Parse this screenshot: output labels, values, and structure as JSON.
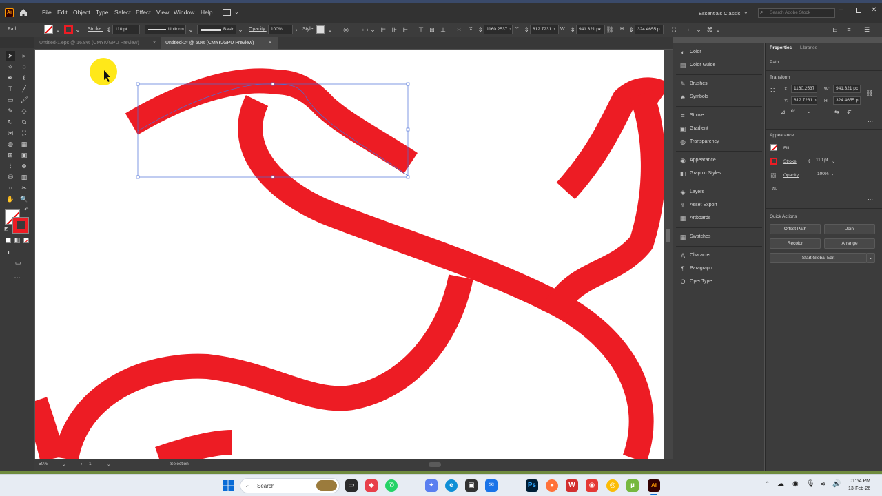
{
  "menubar": {
    "app_badge": "Ai",
    "items": [
      "File",
      "Edit",
      "Object",
      "Type",
      "Select",
      "Effect",
      "View",
      "Window",
      "Help"
    ],
    "workspace": "Essentials Classic",
    "search_placeholder": "Search Adobe Stock"
  },
  "controlbar": {
    "selection_type": "Path",
    "stroke_label": "Stroke:",
    "stroke_value": "110 pt",
    "profile": "Uniform",
    "brush": "Basic",
    "opacity_label": "Opacity:",
    "opacity_value": "100%",
    "style_label": "Style:",
    "x_label": "X:",
    "x_value": "1160.2537 p",
    "y_label": "Y:",
    "y_value": "812.7231 p",
    "w_label": "W:",
    "w_value": "941.321 px",
    "h_label": "H:",
    "h_value": "324.4655 p"
  },
  "tabs": [
    {
      "label": "Untitled-1.eps @ 16.8% (CMYK/GPU Preview)",
      "close": "×"
    },
    {
      "label": "Untitled-2* @ 50% (CMYK/GPU Preview)",
      "close": "×"
    }
  ],
  "statusbar": {
    "zoom": "50%",
    "artboard": "1",
    "tool": "Selection"
  },
  "panels": [
    {
      "label": "Color",
      "icon": "color-icon"
    },
    {
      "label": "Color Guide",
      "icon": "color-guide-icon"
    },
    {
      "label": "Brushes",
      "icon": "brushes-icon"
    },
    {
      "label": "Symbols",
      "icon": "symbols-icon"
    },
    {
      "label": "Stroke",
      "icon": "stroke-icon"
    },
    {
      "label": "Gradient",
      "icon": "gradient-icon"
    },
    {
      "label": "Transparency",
      "icon": "transparency-icon"
    },
    {
      "label": "Appearance",
      "icon": "appearance-icon"
    },
    {
      "label": "Graphic Styles",
      "icon": "graphic-styles-icon"
    },
    {
      "label": "Layers",
      "icon": "layers-icon"
    },
    {
      "label": "Asset Export",
      "icon": "asset-export-icon"
    },
    {
      "label": "Artboards",
      "icon": "artboards-icon"
    },
    {
      "label": "Swatches",
      "icon": "swatches-icon"
    },
    {
      "label": "Character",
      "icon": "character-icon"
    },
    {
      "label": "Paragraph",
      "icon": "paragraph-icon"
    },
    {
      "label": "OpenType",
      "icon": "opentype-icon"
    }
  ],
  "properties": {
    "tab_properties": "Properties",
    "tab_libraries": "Libraries",
    "object_type": "Path",
    "transform_title": "Transform",
    "x_label": "X:",
    "x_value": "1160.2537",
    "w_label": "W:",
    "w_value": "941.321 px",
    "y_label": "Y:",
    "y_value": "812.7231 p",
    "h_label": "H:",
    "h_value": "324.4655 p",
    "angle_value": "0°",
    "appearance_title": "Appearance",
    "fill_label": "Fill",
    "stroke_label": "Stroke",
    "stroke_value": "110 pt",
    "opacity_label": "Opacity",
    "opacity_value": "100%",
    "fx_label": "fx.",
    "quick_actions_title": "Quick Actions",
    "btn_offset_path": "Offset Path",
    "btn_join": "Join",
    "btn_recolor": "Recolor",
    "btn_arrange": "Arrange",
    "btn_global_edit": "Start Global Edit"
  },
  "taskbar": {
    "search_label": "Search",
    "time": "01:54 PM",
    "date": "13-Feb-26"
  },
  "colors": {
    "stroke_red": "#ed1c24",
    "selection_blue": "#4a6fd8",
    "cursor_highlight": "#ffe600"
  }
}
